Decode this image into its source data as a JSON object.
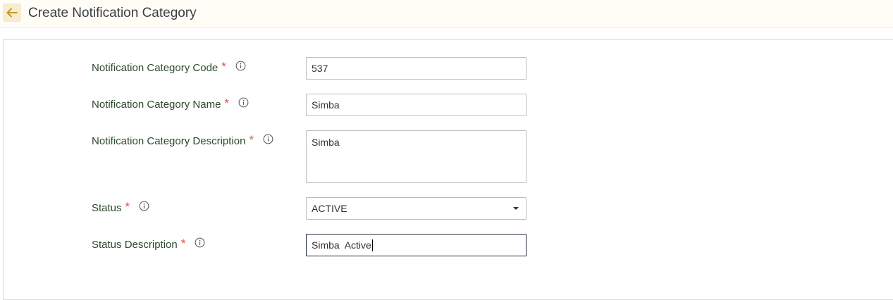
{
  "header": {
    "title": "Create Notification Category",
    "back_icon": "arrow-left-icon",
    "accent_color": "#c8961e"
  },
  "form": {
    "fields": [
      {
        "label": "Notification Category Code",
        "required_mark": "*",
        "value": "537",
        "type": "text"
      },
      {
        "label": "Notification Category Name",
        "required_mark": "*",
        "value": "Simba",
        "type": "text"
      },
      {
        "label": "Notification Category Description",
        "required_mark": "*",
        "value": "Simba",
        "type": "textarea"
      },
      {
        "label": "Status",
        "required_mark": "*",
        "value": "ACTIVE",
        "type": "select"
      },
      {
        "label": "Status Description",
        "required_mark": "*",
        "value": "Simba  Active",
        "type": "text"
      }
    ]
  }
}
